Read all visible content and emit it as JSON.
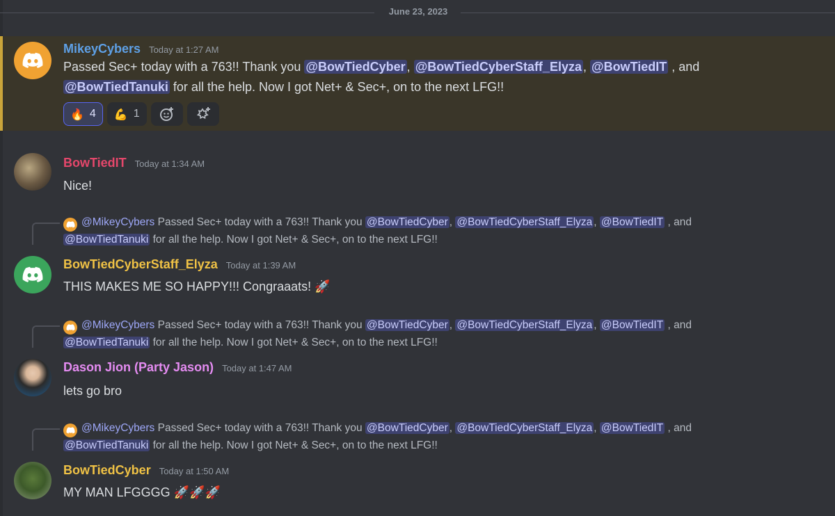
{
  "date_divider": "June 23, 2023",
  "colors": {
    "accent": "#5865f2",
    "highlight_bar": "#c9a43a"
  },
  "original_message": {
    "author": "MikeyCybers",
    "author_color": "#5ea0e6",
    "timestamp": "Today at 1:27 AM",
    "text_1": "Passed Sec+ today with a 763!! Thank you",
    "mention_1": "@BowTiedCyber",
    "sep_1": ",",
    "mention_2": "@BowTiedCyberStaff_Elyza",
    "sep_2": ",",
    "mention_3": "@BowTiedIT",
    "sep_3": ", and",
    "mention_4": "@BowTiedTanuki",
    "text_2": "for all the help. Now I got Net+ & Sec+, on to the next LFG!!",
    "reactions": [
      {
        "emoji": "🔥",
        "count": "4",
        "icon": "fire-icon"
      },
      {
        "emoji": "💪",
        "count": "1",
        "icon": "flexed-biceps-icon"
      }
    ]
  },
  "reply_preview": {
    "author": "@MikeyCybers",
    "text_1": "Passed Sec+ today with a 763!! Thank you",
    "mention_1": "@BowTiedCyber",
    "sep_1": ",",
    "mention_2": "@BowTiedCyberStaff_Elyza",
    "sep_2": ",",
    "mention_3": "@BowTiedIT",
    "sep_3": ", and",
    "mention_4": "@BowTiedTanuki",
    "text_2": "for all the help. Now I got Net+ & Sec+, on to the next LFG!!"
  },
  "messages": [
    {
      "author": "BowTiedIT",
      "color": "#e5476b",
      "timestamp": "Today at 1:34 AM",
      "text": "Nice!"
    },
    {
      "author": "BowTiedCyberStaff_Elyza",
      "color": "#f0c245",
      "timestamp": "Today at 1:39 AM",
      "text": "THIS MAKES ME SO HAPPY!!! Congraaats! 🚀"
    },
    {
      "author": "Dason Jion (Party Jason)",
      "color": "#e58cf2",
      "timestamp": "Today at 1:47 AM",
      "text": "lets go bro"
    },
    {
      "author": "BowTiedCyber",
      "color": "#f0c245",
      "timestamp": "Today at 1:50 AM",
      "text": "MY MAN LFGGGG 🚀🚀🚀"
    }
  ]
}
